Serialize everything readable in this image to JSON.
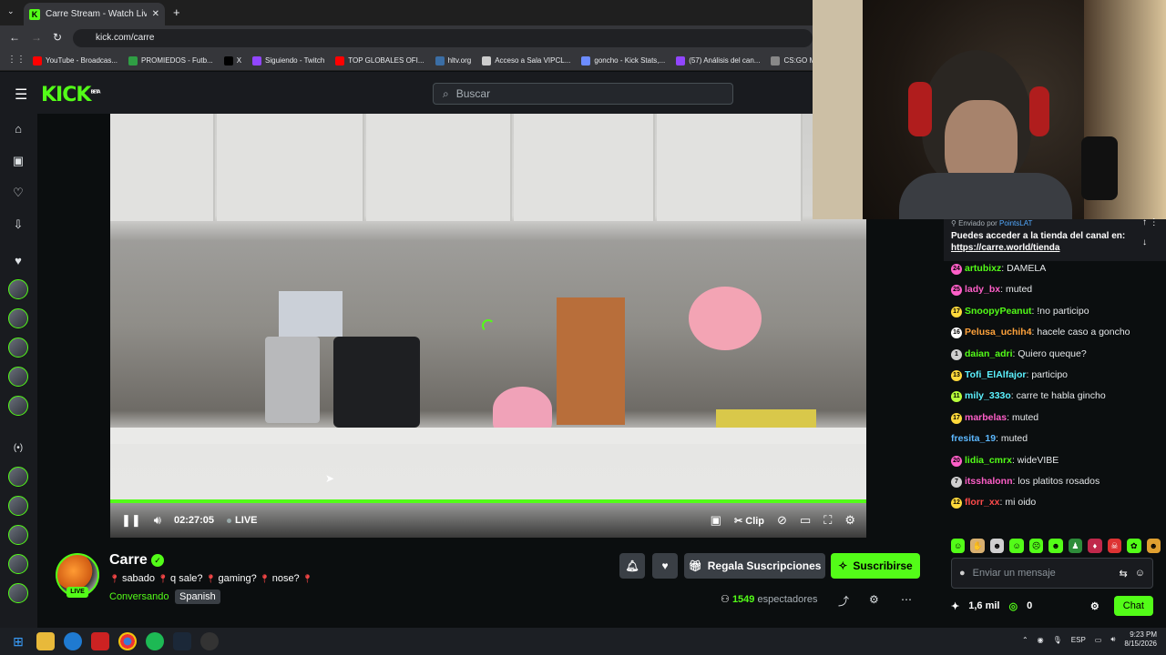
{
  "browser": {
    "tab_title": "Carre Stream - Watch Live on K",
    "url": "kick.com/carre",
    "bookmarks": [
      {
        "label": "YouTube - Broadcas...",
        "color": "#ff0000"
      },
      {
        "label": "PROMIEDOS - Futb...",
        "color": "#2f9e44"
      },
      {
        "label": "X",
        "color": "#000000"
      },
      {
        "label": "Siguiendo - Twitch",
        "color": "#9146ff"
      },
      {
        "label": "TOP GLOBALES OFI...",
        "color": "#ff0000"
      },
      {
        "label": "hltv.org",
        "color": "#3b6ea5"
      },
      {
        "label": "Acceso a Sala VIPCL...",
        "color": "#cccccc"
      },
      {
        "label": "goncho - Kick Stats,...",
        "color": "#6c8cff"
      },
      {
        "label": "(57) Análisis del can...",
        "color": "#9146ff"
      },
      {
        "label": "CS:GO Major M...",
        "color": "#888888"
      }
    ]
  },
  "header": {
    "logo": "KICK",
    "logo_beta": "BETA",
    "search_placeholder": "Buscar"
  },
  "player": {
    "time": "02:27:05",
    "live_label": "LIVE",
    "clip_label": "Clip",
    "progress": 1.0
  },
  "pinned": {
    "sent_by_prefix": "Enviado por",
    "sent_by_user": "PointsLAT",
    "message": "Puedes acceder a la tienda del canal en:",
    "link": "https://carre.world/tienda"
  },
  "chat": [
    {
      "badge": "24",
      "badge_color": "#ff5fc8",
      "user": "artubixz",
      "user_color": "#53fc18",
      "text": ": DAMELA"
    },
    {
      "badge": "25",
      "badge_color": "#ff5fc8",
      "user": "lady_bx",
      "user_color": "#ff5fc8",
      "text": ": muted"
    },
    {
      "badge": "17",
      "badge_color": "#ffd93b",
      "user": "SnoopyPeanut",
      "user_color": "#53fc18",
      "text": ": !no participo"
    },
    {
      "badge": "16",
      "badge_color": "#ffffff",
      "user": "Pelusa_uchih4",
      "user_color": "#ffa23b",
      "text": ": hacele caso a goncho"
    },
    {
      "badge": "1",
      "badge_color": "#cfcfcf",
      "user": "daian_adri",
      "user_color": "#53fc18",
      "text": ": Quiero queque?"
    },
    {
      "badge": "13",
      "badge_color": "#ffd93b",
      "user": "Tofi_ElAlfajor",
      "user_color": "#5cf2ff",
      "text": ": participo"
    },
    {
      "badge": "11",
      "badge_color": "#b7ff3b",
      "user": "mily_333o",
      "user_color": "#5cf2ff",
      "text": ": carre te habla gincho"
    },
    {
      "badge": "17",
      "badge_color": "#ffd93b",
      "user": "marbelas",
      "user_color": "#ff5fc8",
      "text": ": muted"
    },
    {
      "badge": "",
      "badge_color": "",
      "user": "fresita_19",
      "user_color": "#5cb8ff",
      "text": ": muted"
    },
    {
      "badge": "20",
      "badge_color": "#ff5fc8",
      "user": "lidia_cmrx",
      "user_color": "#53fc18",
      "text": ": wideVIBE"
    },
    {
      "badge": "7",
      "badge_color": "#cfcfcf",
      "user": "itsshalonn",
      "user_color": "#ff5fc8",
      "text": ": los platitos rosados"
    },
    {
      "badge": "12",
      "badge_color": "#ffd93b",
      "user": "florr_xx",
      "user_color": "#ff4b4b",
      "text": ": mi oido"
    }
  ],
  "chat_input": {
    "placeholder": "Enviar un mensaje",
    "points": "1,6 mil",
    "kicks": "0",
    "chat_button": "Chat"
  },
  "channel": {
    "name": "Carre",
    "live": "LIVE",
    "title": "sabado q sale? gaming? nose?",
    "category": "Conversando",
    "language": "Spanish",
    "gift_label": "Regala Suscripciones",
    "subscribe_label": "Suscribirse",
    "viewers_count": "1549",
    "viewers_label": "espectadores"
  },
  "taskbar": {
    "lang": "ESP",
    "time": "9:23 PM",
    "date": "8/15/2026"
  }
}
